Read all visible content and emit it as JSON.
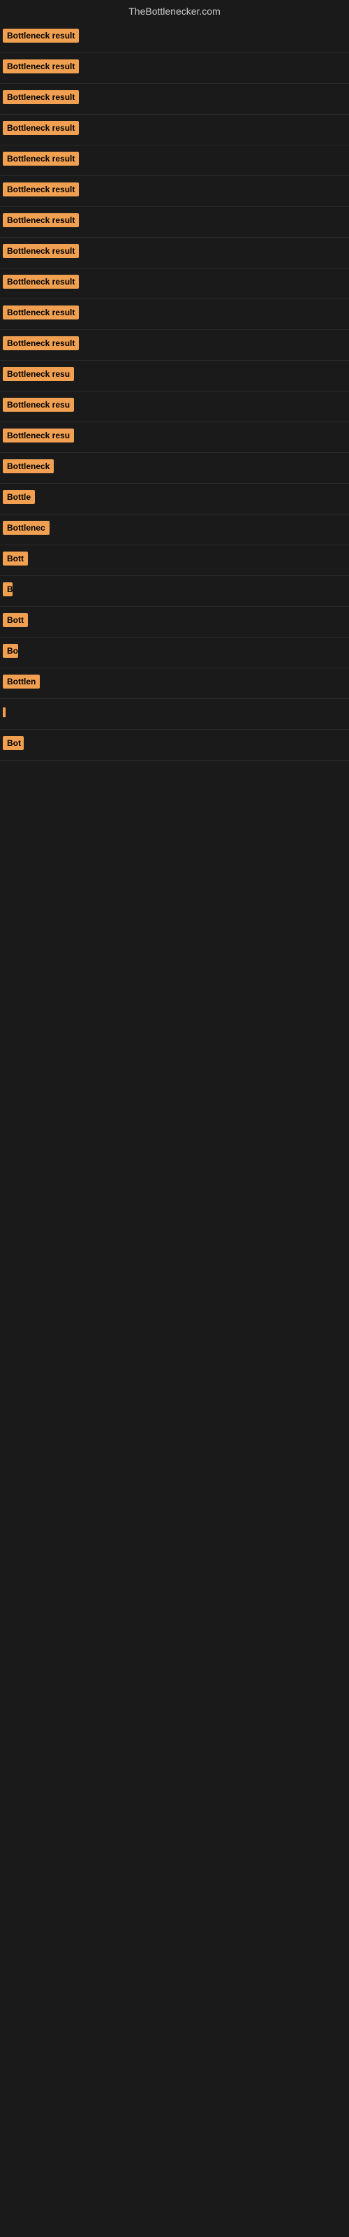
{
  "site": {
    "title": "TheBottlenecker.com"
  },
  "rows": [
    {
      "id": 1,
      "label": "Bottleneck result",
      "width": 155
    },
    {
      "id": 2,
      "label": "Bottleneck result",
      "width": 155
    },
    {
      "id": 3,
      "label": "Bottleneck result",
      "width": 155
    },
    {
      "id": 4,
      "label": "Bottleneck result",
      "width": 155
    },
    {
      "id": 5,
      "label": "Bottleneck result",
      "width": 155
    },
    {
      "id": 6,
      "label": "Bottleneck result",
      "width": 155
    },
    {
      "id": 7,
      "label": "Bottleneck result",
      "width": 155
    },
    {
      "id": 8,
      "label": "Bottleneck result",
      "width": 155
    },
    {
      "id": 9,
      "label": "Bottleneck result",
      "width": 155
    },
    {
      "id": 10,
      "label": "Bottleneck result",
      "width": 155
    },
    {
      "id": 11,
      "label": "Bottleneck result",
      "width": 155
    },
    {
      "id": 12,
      "label": "Bottleneck resu",
      "width": 130
    },
    {
      "id": 13,
      "label": "Bottleneck resu",
      "width": 130
    },
    {
      "id": 14,
      "label": "Bottleneck resu",
      "width": 130
    },
    {
      "id": 15,
      "label": "Bottleneck",
      "width": 90
    },
    {
      "id": 16,
      "label": "Bottle",
      "width": 55
    },
    {
      "id": 17,
      "label": "Bottlenec",
      "width": 78
    },
    {
      "id": 18,
      "label": "Bott",
      "width": 40
    },
    {
      "id": 19,
      "label": "B",
      "width": 14
    },
    {
      "id": 20,
      "label": "Bott",
      "width": 40
    },
    {
      "id": 21,
      "label": "Bo",
      "width": 22
    },
    {
      "id": 22,
      "label": "Bottlen",
      "width": 62
    },
    {
      "id": 23,
      "label": "",
      "width": 4
    },
    {
      "id": 24,
      "label": "Bot",
      "width": 30
    }
  ]
}
